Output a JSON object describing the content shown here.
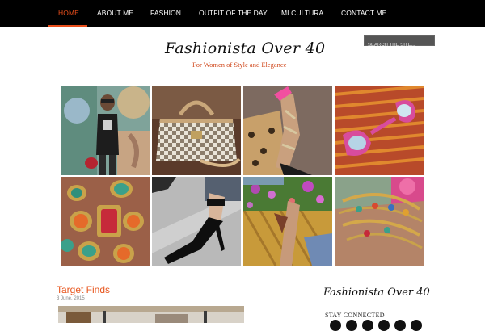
{
  "nav": {
    "items": [
      {
        "label": "HOME",
        "active": true
      },
      {
        "label": "ABOUT ME"
      },
      {
        "label": "FASHION"
      },
      {
        "label": "OUTFIT OF THE DAY"
      },
      {
        "label": "MI CULTURA"
      },
      {
        "label": "CONTACT ME"
      }
    ]
  },
  "logo": {
    "title": "Fashionista Over 40",
    "tagline": "For Women of Style and Elegance"
  },
  "search": {
    "placeholder": "SEARCH THE SITE..."
  },
  "grid": {
    "tiles": [
      {
        "subject": "woman in black tee by painted wall"
      },
      {
        "subject": "checkered designer handbag"
      },
      {
        "subject": "pink studded heels"
      },
      {
        "subject": "pink sunglasses on striped fabric"
      },
      {
        "subject": "orange and turquoise statement necklace"
      },
      {
        "subject": "black pointed heels with ankle strap"
      },
      {
        "subject": "legs on deck with purple flowers"
      },
      {
        "subject": "stacked bead and gold bracelets"
      }
    ]
  },
  "post": {
    "title": "Target Finds",
    "date": "3 June, 2015"
  },
  "sidebar": {
    "logo": "Fashionista Over 40",
    "heading": "STAY CONNECTED"
  },
  "colors": {
    "accent": "#e94e1b",
    "nav_background": "#000000"
  }
}
